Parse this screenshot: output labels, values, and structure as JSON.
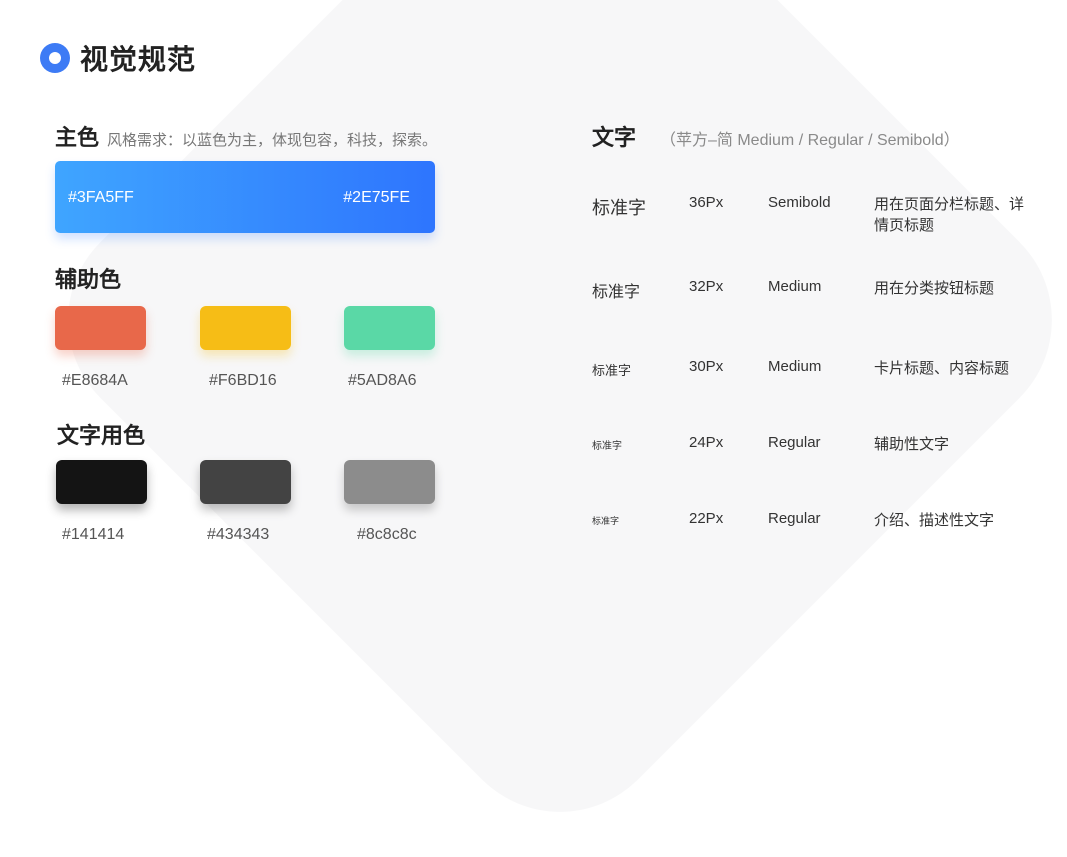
{
  "header": {
    "title": "视觉规范"
  },
  "primary": {
    "title": "主色",
    "note": "风格需求：以蓝色为主，体现包容，科技，探索。",
    "gradient_start": "#3FA5FF",
    "gradient_end": "#2E75FE"
  },
  "secondary": {
    "title": "辅助色",
    "colors": [
      "#E8684A",
      "#F6BD16",
      "#5AD8A6"
    ]
  },
  "text_colors": {
    "title": "文字用色",
    "colors": [
      "#141414",
      "#434343",
      "#8c8c8c"
    ]
  },
  "typography": {
    "title": "文字",
    "note": "（苹方–简   Medium / Regular / Semibold）",
    "rows": [
      {
        "sample": "标准字",
        "size": "36Px",
        "weight": "Semibold",
        "usage": "用在页面分栏标题、详情页标题"
      },
      {
        "sample": "标准字",
        "size": "32Px",
        "weight": "Medium",
        "usage": "用在分类按钮标题"
      },
      {
        "sample": "标准字",
        "size": "30Px",
        "weight": "Medium",
        "usage": "卡片标题、内容标题"
      },
      {
        "sample": "标准字",
        "size": "24Px",
        "weight": "Regular",
        "usage": "辅助性文字"
      },
      {
        "sample": "标准字",
        "size": "22Px",
        "weight": "Regular",
        "usage": "介绍、描述性文字"
      }
    ]
  }
}
